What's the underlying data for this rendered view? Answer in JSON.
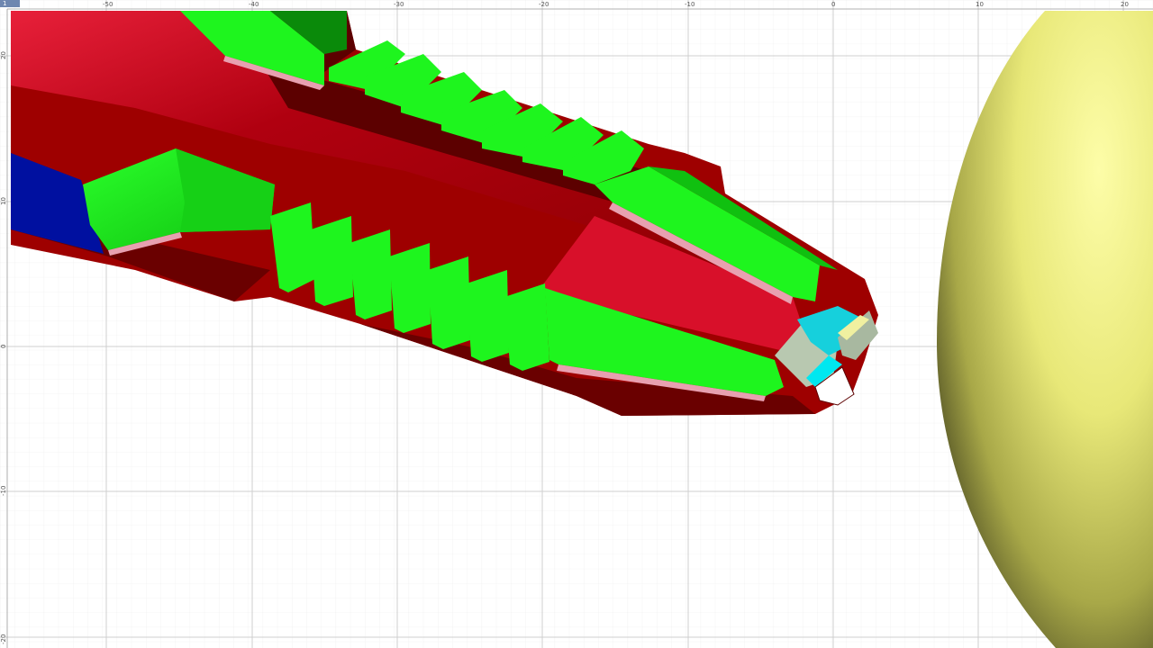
{
  "viewport": {
    "tab_label": "1",
    "x_ticks": [
      "-50",
      "-40",
      "-30",
      "-20",
      "-10",
      "0",
      "10",
      "20"
    ],
    "y_ticks": [
      "20",
      "10",
      "0",
      "-10",
      "-20"
    ]
  },
  "colors": {
    "background": "#ffffff",
    "grid_minor": "#ececec",
    "grid_major": "#cfcfcf",
    "body_red": "#9e0000",
    "body_dark": "#5c0000",
    "face_bright_red": "#d8102a",
    "feature_green": "#1ef51e",
    "feature_dark_green": "#0a8a0a",
    "edge_pink": "#e8a0b0",
    "cyan_patch": "#16d0dc",
    "gray_tip": "#b8c8b0",
    "blue_patch": "#0010a0",
    "sphere_light": "#fbfb9a",
    "sphere_dark": "#5a5a28"
  },
  "objects": {
    "tool_model": "tool-model",
    "sphere": "workpiece-sphere"
  }
}
